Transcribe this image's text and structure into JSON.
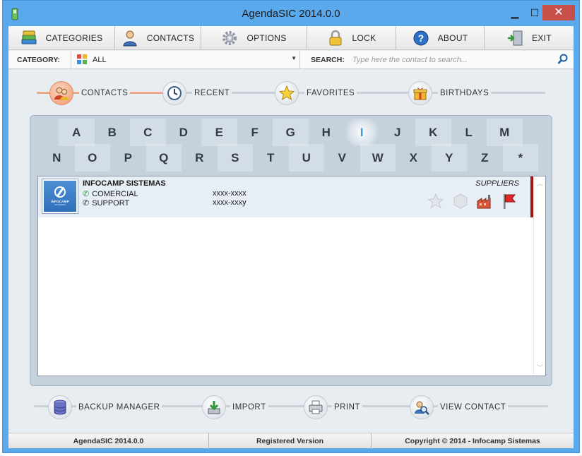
{
  "window": {
    "title": "AgendaSIC 2014.0.0",
    "minimize_glyph": "▁",
    "maximize_glyph": "☐",
    "close_glyph": "✕"
  },
  "menu": {
    "items": [
      {
        "label": "CATEGORIES",
        "icon": "books-icon"
      },
      {
        "label": "CONTACTS",
        "icon": "person-icon"
      },
      {
        "label": "OPTIONS",
        "icon": "gear-icon"
      },
      {
        "label": "LOCK",
        "icon": "padlock-icon"
      },
      {
        "label": "ABOUT",
        "icon": "help-icon"
      },
      {
        "label": "EXIT",
        "icon": "exit-door-icon"
      }
    ]
  },
  "filter": {
    "category_label": "CATEGORY:",
    "category_value": "ALL",
    "search_label": "SEARCH:",
    "search_placeholder": "Type here the contact to search..."
  },
  "nav_tabs": [
    {
      "label": "CONTACTS",
      "icon": "contacts-people-icon",
      "active": true
    },
    {
      "label": "RECENT",
      "icon": "clock-icon",
      "active": false
    },
    {
      "label": "FAVORITES",
      "icon": "star-icon",
      "active": false
    },
    {
      "label": "BIRTHDAYS",
      "icon": "gift-icon",
      "active": false
    }
  ],
  "alphabet": {
    "row1": [
      "A",
      "B",
      "C",
      "D",
      "E",
      "F",
      "G",
      "H",
      "I",
      "J",
      "K",
      "L",
      "M"
    ],
    "row2": [
      "N",
      "O",
      "P",
      "Q",
      "R",
      "S",
      "T",
      "U",
      "V",
      "W",
      "X",
      "Y",
      "Z",
      "*"
    ],
    "active_letter": "I"
  },
  "contacts": [
    {
      "name": "INFOCAMP SISTEMAS",
      "category": "SUPPLIERS",
      "logo_text": "INFOCAMP",
      "logo_sub": "SISTEMAS",
      "phones": [
        {
          "label": "COMERCIAL",
          "number": "xxxx-xxxx"
        },
        {
          "label": "SUPPORT",
          "number": "xxxx-xxxy"
        }
      ]
    }
  ],
  "bottom_buttons": [
    {
      "label": "BACKUP MANAGER",
      "icon": "database-icon"
    },
    {
      "label": "IMPORT",
      "icon": "import-icon"
    },
    {
      "label": "PRINT",
      "icon": "printer-icon"
    },
    {
      "label": "VIEW CONTACT",
      "icon": "view-contact-icon"
    }
  ],
  "status": {
    "app": "AgendaSIC 2014.0.0",
    "version": "Registered Version",
    "copyright": "Copyright © 2014 - Infocamp Sistemas"
  },
  "colors": {
    "window_frame": "#5aa9ec",
    "close_button": "#c7504a",
    "active_letter": "#3a9be0",
    "row_highlight": "#e7eef6",
    "marker_bar": "#a31616"
  }
}
